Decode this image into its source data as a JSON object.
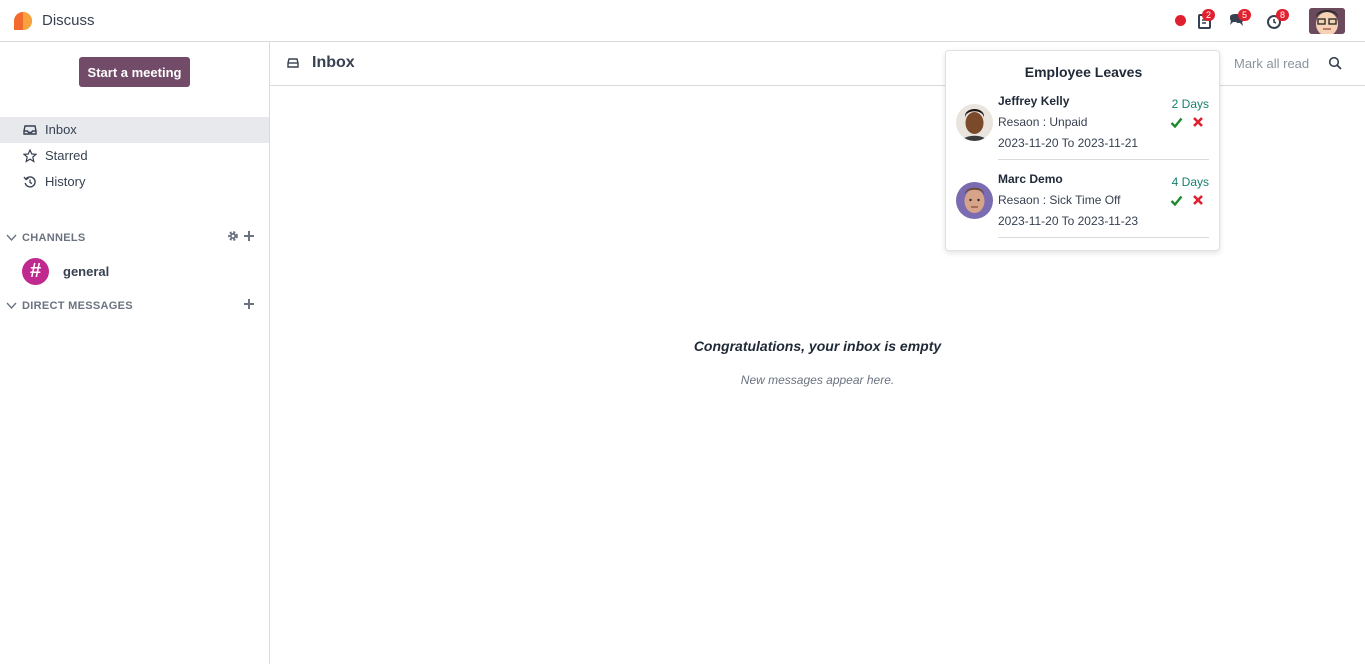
{
  "app": {
    "title": "Discuss"
  },
  "navbar": {
    "badges": {
      "activities": "2",
      "messages": "5",
      "clock": "8"
    }
  },
  "sidebar": {
    "start_meeting": "Start a meeting",
    "items": [
      {
        "label": "Inbox",
        "icon": "inbox-icon",
        "active": true
      },
      {
        "label": "Starred",
        "icon": "star-icon",
        "active": false
      },
      {
        "label": "History",
        "icon": "history-icon",
        "active": false
      }
    ],
    "channels_header": "CHANNELS",
    "channels": [
      {
        "name": "general",
        "color": "#c02a8e"
      }
    ],
    "dm_header": "DIRECT MESSAGES"
  },
  "main": {
    "title": "Inbox",
    "mark_all_read": "Mark all read",
    "empty_title": "Congratulations, your inbox is empty",
    "empty_sub": "New messages appear here."
  },
  "popover": {
    "title": "Employee Leaves",
    "leaves": [
      {
        "name": "Jeffrey Kelly",
        "days": "2 Days",
        "reason": "Resaon : Unpaid",
        "dates": "2023-11-20 To 2023-11-21"
      },
      {
        "name": "Marc Demo",
        "days": "4 Days",
        "reason": "Resaon : Sick Time Off",
        "dates": "2023-11-20 To 2023-11-23"
      }
    ]
  },
  "colors": {
    "brand": "#714b67",
    "accent_green": "#17806d",
    "approve": "#1e8a2e",
    "refuse": "#e0202f",
    "badge": "#e0202f"
  }
}
